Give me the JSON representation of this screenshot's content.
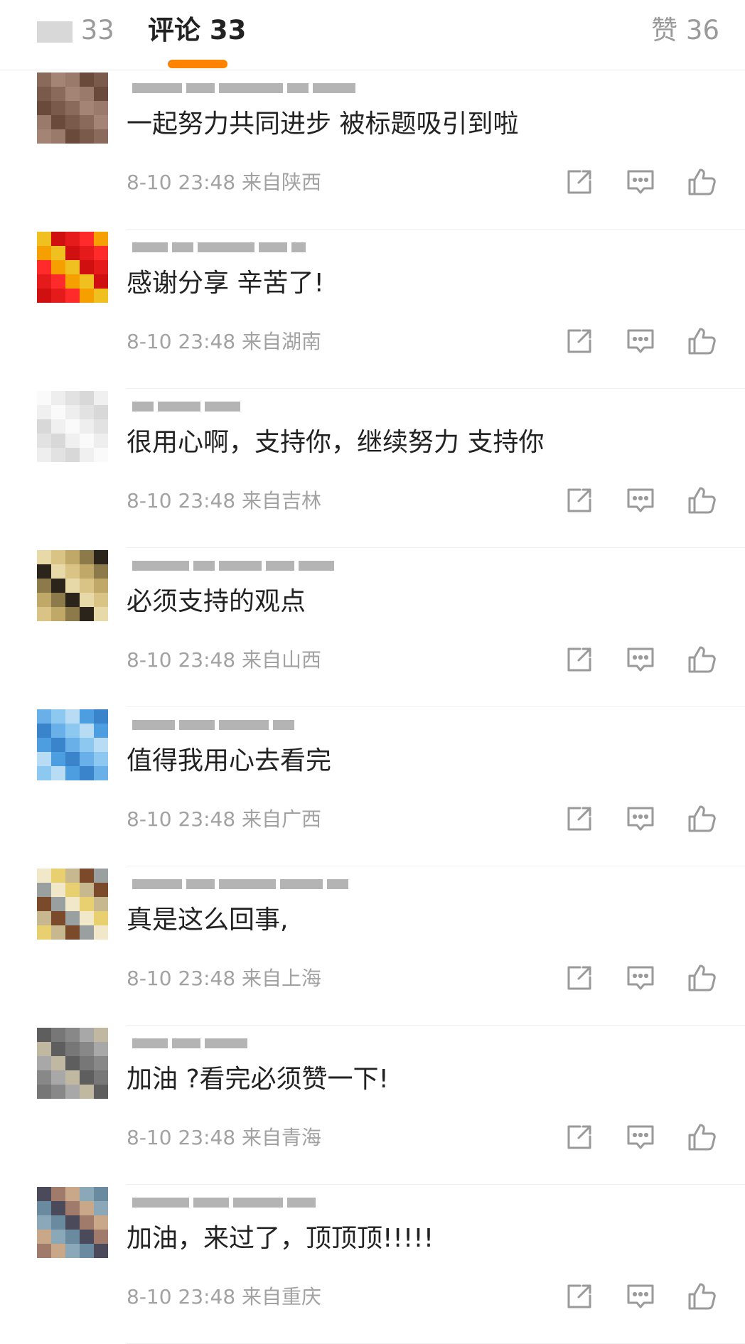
{
  "tabs": {
    "repost_count": "33",
    "comment_label": "评论",
    "comment_count": "33",
    "like_label": "赞",
    "like_count": "36",
    "accent_color": "#ff8200"
  },
  "comments": [
    {
      "text": "一起努力共同进步 被标题吸引到啦",
      "time": "8-10 23:48",
      "location": "来自陕西",
      "avatar_colors": [
        "#8a6a5a",
        "#6a4a3a",
        "#a48474",
        "#7a5a4a",
        "#9a7a6a"
      ]
    },
    {
      "text": "感谢分享 辛苦了!",
      "time": "8-10 23:48",
      "location": "来自湖南",
      "avatar_colors": [
        "#e51a1a",
        "#f0c020",
        "#ff2a2a",
        "#d01010",
        "#f5a000"
      ]
    },
    {
      "text": "很用心啊，支持你，继续努力 支持你",
      "time": "8-10 23:48",
      "location": "来自吉林",
      "avatar_colors": [
        "#f0f0f0",
        "#e2e2e2",
        "#fafafa",
        "#d8d8d8",
        "#eeeeee"
      ]
    },
    {
      "text": "必须支持的观点",
      "time": "8-10 23:48",
      "location": "来自山西",
      "avatar_colors": [
        "#d9c486",
        "#2a241a",
        "#bfa868",
        "#e8d9a8",
        "#8c7a4a"
      ]
    },
    {
      "text": "值得我用心去看完",
      "time": "8-10 23:48",
      "location": "来自广西",
      "avatar_colors": [
        "#4d9ee0",
        "#8cc8f0",
        "#3a84cc",
        "#b8dcf4",
        "#6ab0e8"
      ]
    },
    {
      "text": "真是这么回事,",
      "time": "8-10 23:48",
      "location": "来自上海",
      "avatar_colors": [
        "#f0e8c8",
        "#7a4a2a",
        "#e8d070",
        "#9aa0a0",
        "#c8b890"
      ]
    },
    {
      "text": "加油 ?看完必须赞一下!",
      "time": "8-10 23:48",
      "location": "来自青海",
      "avatar_colors": [
        "#888888",
        "#5e5e5e",
        "#a8a8a8",
        "#777777",
        "#c0b8a0"
      ]
    },
    {
      "text": "加油，来过了，顶顶顶!!!!!",
      "time": "8-10 23:48",
      "location": "来自重庆",
      "avatar_colors": [
        "#6a8aa0",
        "#c8a888",
        "#4a4a5a",
        "#8aa8b8",
        "#a07a6a"
      ]
    }
  ],
  "actions": {
    "share_icon": "share-icon",
    "reply_icon": "comment-icon",
    "like_icon": "thumbs-up-icon",
    "icon_color": "#9a9a9a"
  }
}
